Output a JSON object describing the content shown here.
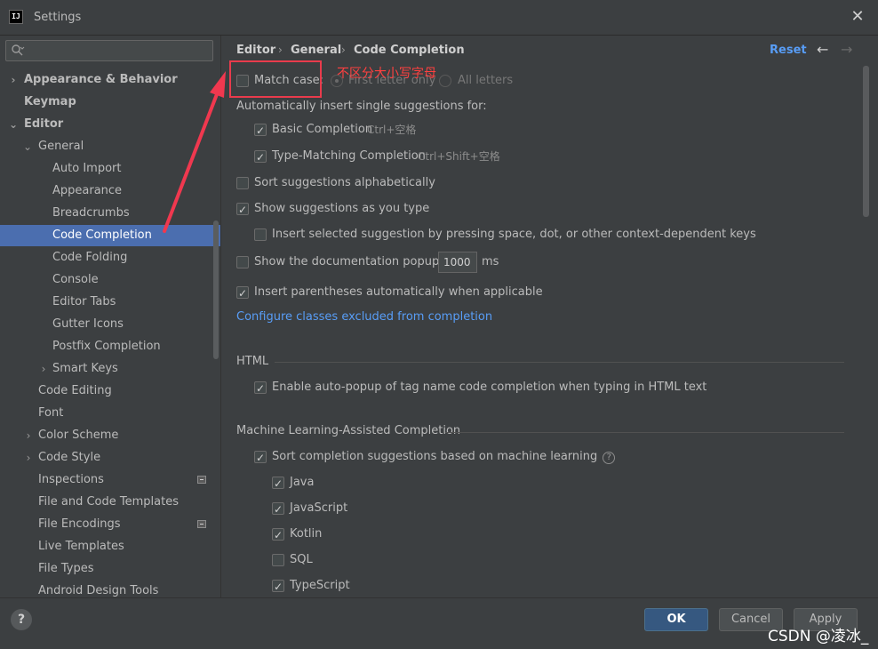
{
  "window": {
    "title": "Settings",
    "app_icon": "IJ"
  },
  "sidebar": {
    "search_placeholder": "",
    "items": [
      {
        "label": "Appearance & Behavior",
        "arrow": "›"
      },
      {
        "label": "Keymap"
      },
      {
        "label": "Editor",
        "arrow": "⌄"
      },
      {
        "label": "General",
        "arrow": "⌄"
      },
      {
        "label": "Auto Import"
      },
      {
        "label": "Appearance"
      },
      {
        "label": "Breadcrumbs"
      },
      {
        "label": "Code Completion"
      },
      {
        "label": "Code Folding"
      },
      {
        "label": "Console"
      },
      {
        "label": "Editor Tabs"
      },
      {
        "label": "Gutter Icons"
      },
      {
        "label": "Postfix Completion"
      },
      {
        "label": "Smart Keys",
        "arrow": "›"
      },
      {
        "label": "Code Editing"
      },
      {
        "label": "Font"
      },
      {
        "label": "Color Scheme",
        "arrow": "›"
      },
      {
        "label": "Code Style",
        "arrow": "›"
      },
      {
        "label": "Inspections"
      },
      {
        "label": "File and Code Templates"
      },
      {
        "label": "File Encodings"
      },
      {
        "label": "Live Templates"
      },
      {
        "label": "File Types"
      },
      {
        "label": "Android Design Tools"
      }
    ]
  },
  "header": {
    "breadcrumb": [
      "Editor",
      "General",
      "Code Completion"
    ],
    "separator": "›",
    "reset": "Reset",
    "back_icon": "←",
    "forward_icon": "→"
  },
  "settings": {
    "match_case": {
      "label": "Match case:",
      "checked": false
    },
    "first_letter_only": "First letter only",
    "all_letters": "All letters",
    "auto_insert_label": "Automatically insert single suggestions for:",
    "basic_completion": {
      "label": "Basic Completion",
      "shortcut": "Ctrl+空格",
      "checked": true
    },
    "type_matching": {
      "label": "Type-Matching Completion",
      "shortcut": "Ctrl+Shift+空格",
      "checked": true
    },
    "sort_alpha": {
      "label": "Sort suggestions alphabetically",
      "checked": false
    },
    "show_as_you_type": {
      "label": "Show suggestions as you type",
      "checked": true
    },
    "insert_selected": {
      "label": "Insert selected suggestion by pressing space, dot, or other context-dependent keys",
      "checked": false
    },
    "doc_popup": {
      "label": "Show the documentation popup in",
      "value": "1000",
      "unit": "ms",
      "checked": false
    },
    "insert_parens": {
      "label": "Insert parentheses automatically when applicable",
      "checked": true
    },
    "configure_link": "Configure classes excluded from completion"
  },
  "html_section": {
    "title": "HTML",
    "auto_popup": {
      "label": "Enable auto-popup of tag name code completion when typing in HTML text",
      "checked": true
    }
  },
  "ml_section": {
    "title": "Machine Learning-Assisted Completion",
    "sort_ml": {
      "label": "Sort completion suggestions based on machine learning",
      "checked": true
    },
    "languages": [
      {
        "label": "Java",
        "checked": true
      },
      {
        "label": "JavaScript",
        "checked": true
      },
      {
        "label": "Kotlin",
        "checked": true
      },
      {
        "label": "SQL",
        "checked": false
      },
      {
        "label": "TypeScript",
        "checked": true
      }
    ]
  },
  "annotation": {
    "text": "不区分大小写字母",
    "color": "#e93b4c"
  },
  "footer": {
    "help": "?",
    "ok": "OK",
    "cancel": "Cancel",
    "apply": "Apply"
  },
  "watermark": "CSDN @凌冰_",
  "colors": {
    "selection": "#4b6eaf",
    "link": "#589df6",
    "ok_button": "#365880"
  }
}
